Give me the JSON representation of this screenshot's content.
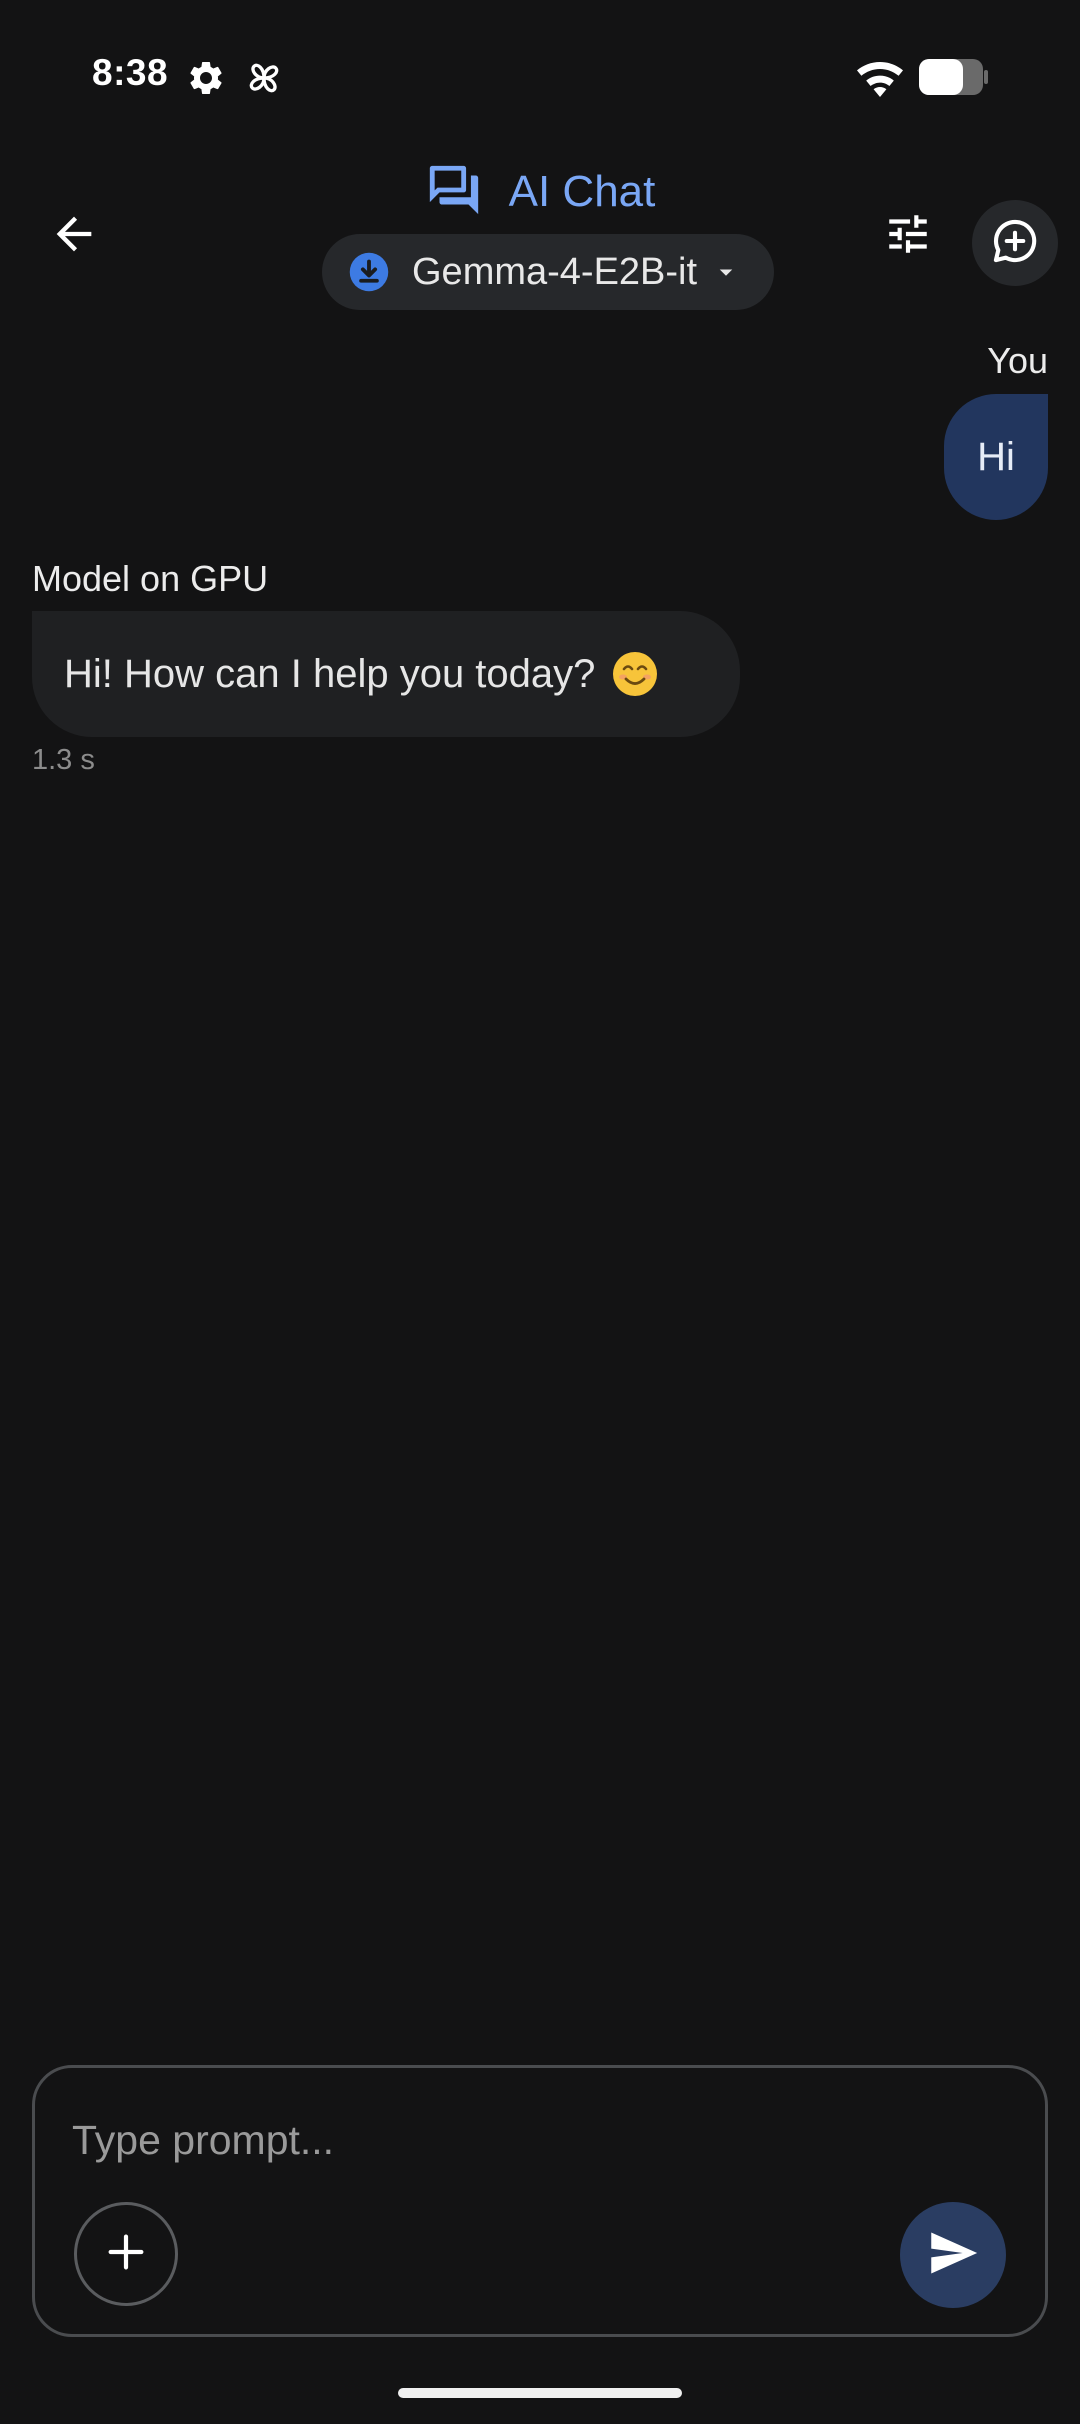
{
  "status_bar": {
    "time": "8:38",
    "icons": [
      "settings-gear-icon",
      "pinwheel-icon",
      "wifi-icon",
      "battery-icon"
    ]
  },
  "header": {
    "back_icon": "arrow-back-icon",
    "title": "AI Chat",
    "title_icon": "forum-icon",
    "title_color": "#7aa7f5",
    "model_selector": {
      "icon": "download-circle-icon",
      "label": "Gemma-4-E2B-it",
      "dropdown_icon": "arrow-drop-down-icon"
    },
    "tune_icon": "tune-sliders-icon",
    "new_chat_icon": "add-comment-icon"
  },
  "messages": [
    {
      "role": "user",
      "label": "You",
      "text": "Hi"
    },
    {
      "role": "model",
      "label": "Model on GPU",
      "text": "Hi! How can I help you today?",
      "emoji": "smiling-face-emoji",
      "latency": "1.3 s"
    }
  ],
  "composer": {
    "placeholder": "Type prompt...",
    "value": "",
    "add_icon": "plus-icon",
    "send_icon": "send-icon"
  },
  "colors": {
    "background": "#131314",
    "user_bubble": "#22365e",
    "model_bubble": "#1f2022",
    "accent": "#7aa7f5",
    "send_button": "#2a3d62"
  }
}
